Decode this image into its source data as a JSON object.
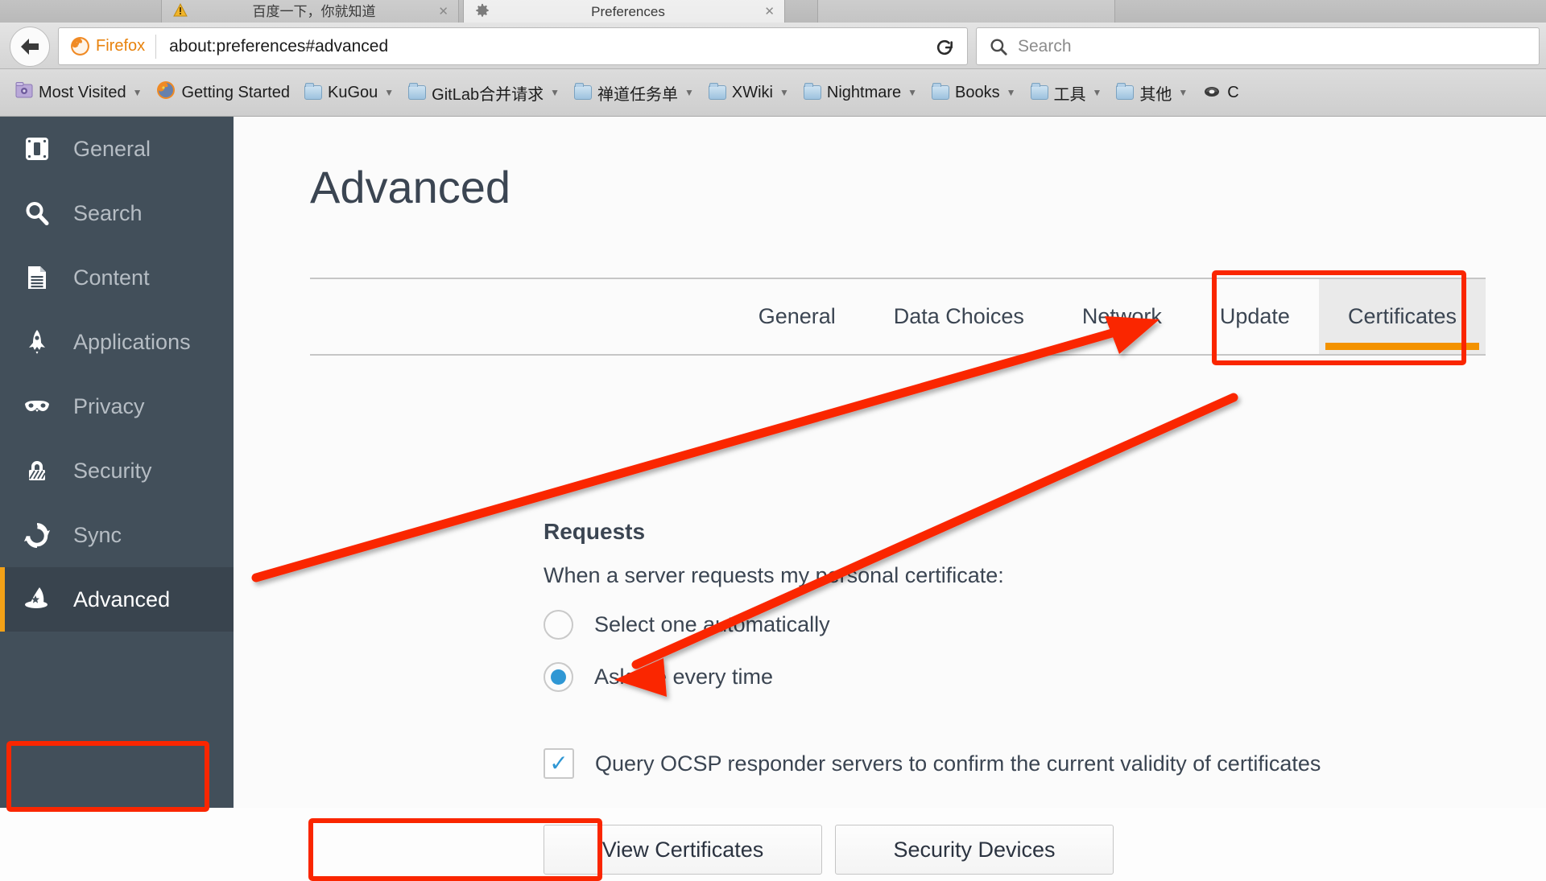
{
  "browser": {
    "tabs": [
      {
        "label": "百度一下，你就知道",
        "favicon": "warning-icon",
        "active": false
      },
      {
        "label": "Preferences",
        "favicon": "gear-icon",
        "active": true
      },
      {
        "label": "",
        "favicon": "blank-icon",
        "active": false
      }
    ],
    "back_button": "back-arrow-icon",
    "identity_label": "Firefox",
    "url": "about:preferences#advanced",
    "reload_button": "reload-icon",
    "search": {
      "placeholder": "Search",
      "icon": "search-icon"
    },
    "bookmarks": [
      {
        "label": "Most Visited",
        "icon": "most-visited-icon",
        "caret": true
      },
      {
        "label": "Getting Started",
        "icon": "firefox-icon",
        "caret": false
      },
      {
        "label": "KuGou",
        "icon": "folder-icon",
        "caret": true
      },
      {
        "label": "GitLab合并请求",
        "icon": "folder-icon",
        "caret": true
      },
      {
        "label": "禅道任务单",
        "icon": "folder-icon",
        "caret": true
      },
      {
        "label": "XWiki",
        "icon": "folder-icon",
        "caret": true
      },
      {
        "label": "Nightmare",
        "icon": "folder-icon",
        "caret": true
      },
      {
        "label": "Books",
        "icon": "folder-icon",
        "caret": true
      },
      {
        "label": "工具",
        "icon": "folder-icon",
        "caret": true
      },
      {
        "label": "其他",
        "icon": "folder-icon",
        "caret": true
      },
      {
        "label": "C",
        "icon": "bookmark-icon",
        "caret": false
      }
    ]
  },
  "sidebar": {
    "items": [
      {
        "label": "General",
        "icon": "general-icon",
        "selected": false
      },
      {
        "label": "Search",
        "icon": "search-icon",
        "selected": false
      },
      {
        "label": "Content",
        "icon": "document-icon",
        "selected": false
      },
      {
        "label": "Applications",
        "icon": "rocket-icon",
        "selected": false
      },
      {
        "label": "Privacy",
        "icon": "mask-icon",
        "selected": false
      },
      {
        "label": "Security",
        "icon": "lock-icon",
        "selected": false
      },
      {
        "label": "Sync",
        "icon": "sync-icon",
        "selected": false
      },
      {
        "label": "Advanced",
        "icon": "wizard-hat-icon",
        "selected": true
      }
    ]
  },
  "main": {
    "title": "Advanced",
    "tabs": [
      {
        "label": "General",
        "active": false
      },
      {
        "label": "Data Choices",
        "active": false
      },
      {
        "label": "Network",
        "active": false
      },
      {
        "label": "Update",
        "active": false
      },
      {
        "label": "Certificates",
        "active": true
      }
    ],
    "requests": {
      "heading": "Requests",
      "description": "When a server requests my personal certificate:",
      "options": [
        {
          "label": "Select one automatically",
          "checked": false
        },
        {
          "label": "Ask me every time",
          "checked": true
        }
      ]
    },
    "ocsp": {
      "label": "Query OCSP responder servers to confirm the current validity of certificates",
      "checked": true,
      "check_glyph": "✓"
    },
    "buttons": [
      {
        "label": "View Certificates",
        "highlighted": true
      },
      {
        "label": "Security Devices",
        "highlighted": false
      }
    ]
  },
  "annotation": {
    "highlight_color": "#fa2600",
    "accent_color": "#f39200",
    "selected_tab_bg": "#eaeaea",
    "sidebar_bg": "#424f5a"
  }
}
